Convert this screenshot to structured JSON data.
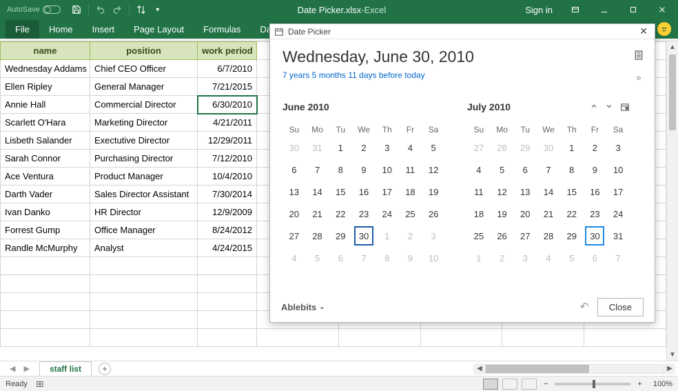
{
  "title": {
    "autosave": "AutoSave",
    "docname": "Date Picker.xlsx",
    "sep": "  -  ",
    "appname": "Excel",
    "signin": "Sign in"
  },
  "ribbon": {
    "tabs": [
      "File",
      "Home",
      "Insert",
      "Page Layout",
      "Formulas",
      "Data"
    ]
  },
  "sheet": {
    "headers": [
      "name",
      "position",
      "work period"
    ],
    "rows": [
      {
        "a": "Wednesday Addams",
        "b": "Chief CEO Officer",
        "c": "6/7/2010"
      },
      {
        "a": "Ellen Ripley",
        "b": "General Manager",
        "c": "7/21/2015"
      },
      {
        "a": "Annie Hall",
        "b": "Commercial Director",
        "c": "6/30/2010",
        "sel": true
      },
      {
        "a": "Scarlett O'Hara",
        "b": "Marketing Director",
        "c": "4/21/2011"
      },
      {
        "a": "Lisbeth Salander",
        "b": "Exectutive Director",
        "c": "12/29/2011"
      },
      {
        "a": "Sarah Connor",
        "b": "Purchasing Director",
        "c": "7/12/2010"
      },
      {
        "a": "Ace Ventura",
        "b": "Product Manager",
        "c": "10/4/2010"
      },
      {
        "a": "Darth Vader",
        "b": "Sales Director Assistant",
        "c": "7/30/2014"
      },
      {
        "a": "Ivan Danko",
        "b": "HR Director",
        "c": "12/9/2009"
      },
      {
        "a": "Forrest Gump",
        "b": "Office Manager",
        "c": "8/24/2012"
      },
      {
        "a": "Randle McMurphy",
        "b": "Analyst",
        "c": "4/24/2015"
      }
    ],
    "blank_rows": 5,
    "tab": "staff list"
  },
  "status": {
    "ready": "Ready",
    "zoom": "100%"
  },
  "picker": {
    "pane_title": "Date Picker",
    "full_date": "Wednesday, June 30, 2010",
    "diff": "7 years 5 months 11 days before today",
    "dow": [
      "Su",
      "Mo",
      "Tu",
      "We",
      "Th",
      "Fr",
      "Sa"
    ],
    "month1": {
      "title": "June 2010",
      "leading_other": [
        30,
        31
      ],
      "days": [
        1,
        2,
        3,
        4,
        5,
        6,
        7,
        8,
        9,
        10,
        11,
        12,
        13,
        14,
        15,
        16,
        17,
        18,
        19,
        20,
        21,
        22,
        23,
        24,
        25,
        26,
        27,
        28,
        29,
        30
      ],
      "trailing_other": [
        1,
        2,
        3,
        4,
        5,
        6,
        7,
        8,
        9,
        10
      ],
      "selected": 30
    },
    "month2": {
      "title": "July 2010",
      "leading_other": [
        27,
        28,
        29,
        30
      ],
      "days": [
        1,
        2,
        3,
        4,
        5,
        6,
        7,
        8,
        9,
        10,
        11,
        12,
        13,
        14,
        15,
        16,
        17,
        18,
        19,
        20,
        21,
        22,
        23,
        24,
        25,
        26,
        27,
        28,
        29,
        30,
        31
      ],
      "trailing_other": [
        1,
        2,
        3,
        4,
        5,
        6,
        7
      ],
      "today": 30
    },
    "brand": "Ablebits",
    "close": "Close"
  }
}
